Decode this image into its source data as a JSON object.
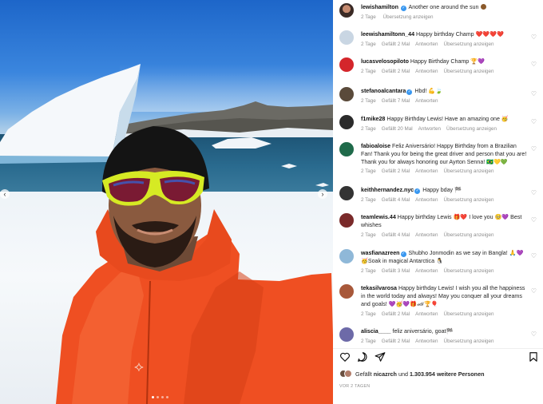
{
  "post": {
    "image_alt": "Selfie in Antarctica",
    "carousel": {
      "prev_icon": "chevron-left-icon",
      "next_icon": "chevron-right-icon",
      "dots": 4,
      "active_dot": 1
    }
  },
  "caption": {
    "username": "lewishamilton",
    "verified": true,
    "text": "Another one around the sun",
    "age": "2 Tage",
    "translate": "Übersetzung anzeigen"
  },
  "comments": [
    {
      "username": "leewishamiltonn_44",
      "verified": false,
      "text": "Happy birthday Champ ❤️❤️❤️❤️",
      "age": "2 Tage",
      "likes": "Gefällt 2 Mal",
      "reply": "Antworten",
      "translate": "Übersetzung anzeigen"
    },
    {
      "username": "lucasvelosopiloto",
      "verified": false,
      "text": "Happy Birthday Champ 🏆💜",
      "age": "2 Tage",
      "likes": "Gefällt 2 Mal",
      "reply": "Antworten",
      "translate": "Übersetzung anzeigen"
    },
    {
      "username": "stefanoalcantara",
      "verified": true,
      "text": "Hbd! 💪🍃",
      "age": "2 Tage",
      "likes": "Gefällt 7 Mal",
      "reply": "Antworten",
      "translate": ""
    },
    {
      "username": "f1mike28",
      "verified": false,
      "text": "Happy Birthday Lewis! Have an amazing one 🥳",
      "age": "2 Tage",
      "likes": "Gefällt 20 Mal",
      "reply": "Antworten",
      "translate": "Übersetzung anzeigen"
    },
    {
      "username": "fabioaloise",
      "verified": false,
      "text": "Feliz Aniversário! Happy Birthday from a Brazilian Fan! Thank you for being the great driver and person that you are! Thank you for always honoring our Ayrton Senna! 🇧🇷💛💚",
      "age": "2 Tage",
      "likes": "Gefällt 2 Mal",
      "reply": "Antworten",
      "translate": "Übersetzung anzeigen"
    },
    {
      "username": "keithhernandez.nyc",
      "verified": true,
      "text": "Happy bday 🏁",
      "age": "2 Tage",
      "likes": "Gefällt 4 Mal",
      "reply": "Antworten",
      "translate": "Übersetzung anzeigen"
    },
    {
      "username": "teamlewis.44",
      "verified": false,
      "text": "Happy birthday Lewis 🎁❤️ I love you 🥺💜 Best whishes",
      "age": "2 Tage",
      "likes": "Gefällt 4 Mal",
      "reply": "Antworten",
      "translate": "Übersetzung anzeigen"
    },
    {
      "username": "wasfianazreen",
      "verified": true,
      "text": "Shubho Jonmodin as we say in Bangla! 🙏💜 🥳Soak in magical Antarctica 🐧",
      "age": "2 Tage",
      "likes": "Gefällt 3 Mal",
      "reply": "Antworten",
      "translate": "Übersetzung anzeigen"
    },
    {
      "username": "tekasilvarosa",
      "verified": false,
      "text": "Happy birthday Lewis! I wish you all the happiness in the world today and always! May you conquer all your dreams and goals! 💜🥳💜🎁🏎🏆🎈",
      "age": "2 Tage",
      "likes": "Gefällt 2 Mal",
      "reply": "Antworten",
      "translate": "Übersetzung anzeigen"
    },
    {
      "username": "aliscia____",
      "verified": false,
      "text": "feliz aniversário, goat🏁",
      "age": "2 Tage",
      "likes": "Gefällt 2 Mal",
      "reply": "Antworten",
      "translate": "Übersetzung anzeigen"
    }
  ],
  "actions": {
    "like_icon": "heart-icon",
    "comment_icon": "comment-icon",
    "share_icon": "share-icon",
    "save_icon": "bookmark-icon"
  },
  "likes_summary": {
    "prefix": "Gefällt",
    "user": "nicazrch",
    "middle": "und",
    "count": "1.303.954",
    "suffix": "weitere Personen"
  },
  "posted": "VOR 2 TAGEN"
}
